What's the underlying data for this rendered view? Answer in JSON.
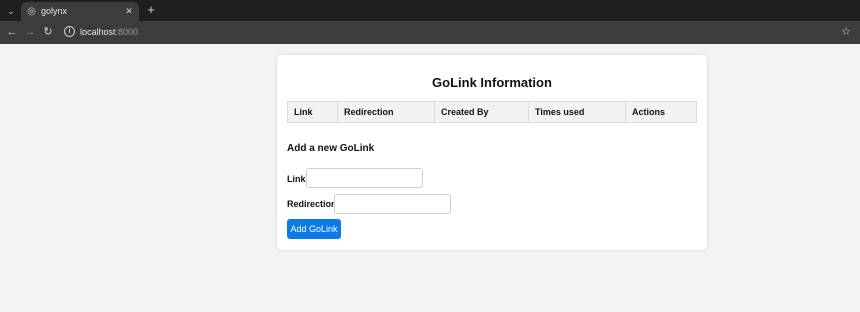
{
  "browser": {
    "tab_title": "golynx",
    "url_host": "localhost",
    "url_port": ":8000"
  },
  "page": {
    "title": "GoLink Information",
    "table": {
      "headers": [
        "Link",
        "Redirection",
        "Created By",
        "Times used",
        "Actions"
      ]
    },
    "form": {
      "title": "Add a new GoLink",
      "link_label": "Link",
      "link_value": "",
      "redirection_label": "Redirection",
      "redirection_value": "",
      "submit_label": "Add GoLink"
    }
  },
  "icons": {
    "tab_menu": "chevron-down-icon",
    "favicon": "globe-icon",
    "tab_close": "close-icon",
    "new_tab": "plus-icon",
    "back": "arrow-left-icon",
    "forward": "arrow-right-icon",
    "reload": "reload-icon",
    "site_info": "info-icon",
    "bookmark": "star-icon"
  },
  "colors": {
    "primary_button": "#0b7be6",
    "chrome_dark": "#1f1f1f",
    "chrome_toolbar": "#3c3c3c",
    "page_background": "#f3f3f3"
  }
}
